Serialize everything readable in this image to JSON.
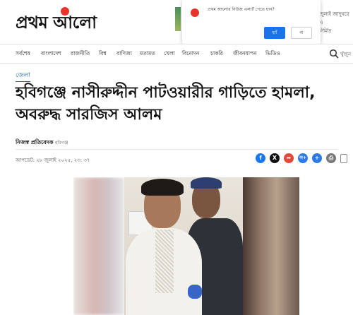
{
  "header": {
    "logo": "প্রথম আলো",
    "side_text_line1": "জুলাই জাদুঘরে এ",
    "side_text_line2": "নির্মিত"
  },
  "popup": {
    "message": "প্রথম আলোর নিউজ এলার্ট পেতে চান?",
    "yes_label": "হ্যাঁ",
    "no_label": "না"
  },
  "nav": {
    "items": [
      "সর্বশেষ",
      "বাংলাদেশ",
      "রাজনীতি",
      "বিশ্ব",
      "বাণিজ্য",
      "মতামত",
      "খেলা",
      "বিনোদন",
      "চাকরি",
      "জীবনযাপন",
      "ভিডিও"
    ],
    "search_label": "খুঁজুন"
  },
  "article": {
    "section": "জেলা",
    "headline": "হবিগঞ্জে নাসীরুদ্দীন পাটওয়ারীর গাড়িতে হামলা, অবরুদ্ধ সারজিস আলম",
    "author": "নিজস্ব প্রতিবেদক",
    "location": "হবিগঞ্জ",
    "date": "আপডেট: ২৮ জুলাই ২০২৫, ২৩: ৩৭"
  },
  "share": {
    "facebook_icon": "f",
    "x_icon": "X",
    "share_icon": "➦",
    "font_size_icon": "অ+",
    "comment_icon": "+",
    "print_icon": "⎙"
  },
  "colors": {
    "brand_red": "#e8342a",
    "link_blue": "#1a5fa8",
    "facebook": "#1877f2",
    "popup_button": "#1a73e8"
  }
}
